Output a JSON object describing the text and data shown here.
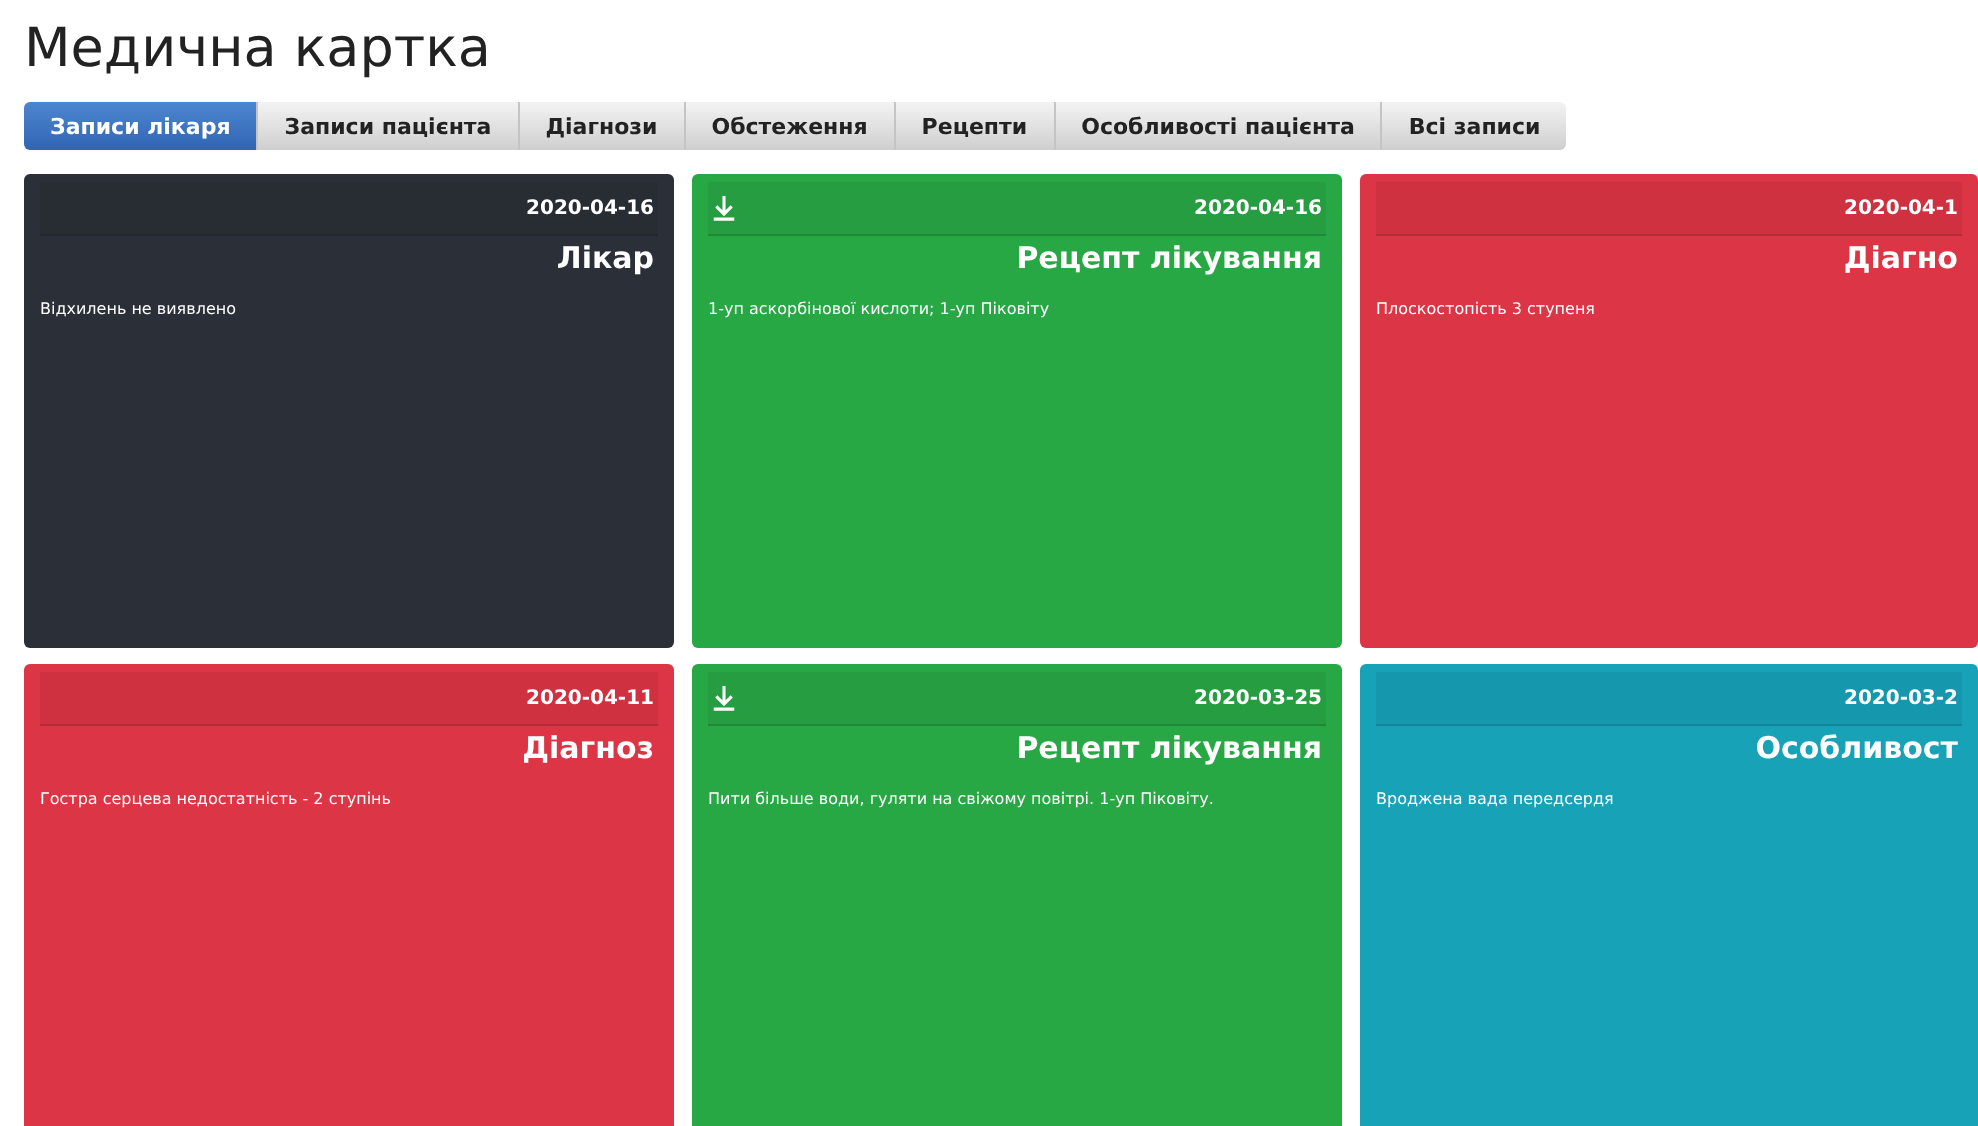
{
  "page_title": "Медична картка",
  "tabs": [
    {
      "label": "Записи лікаря",
      "selected": true
    },
    {
      "label": "Записи пацієнта",
      "selected": false
    },
    {
      "label": "Діагнози",
      "selected": false
    },
    {
      "label": "Обстеження",
      "selected": false
    },
    {
      "label": "Рецепти",
      "selected": false
    },
    {
      "label": "Особливості пацієнта",
      "selected": false
    },
    {
      "label": "Всі записи",
      "selected": false
    }
  ],
  "cards": [
    {
      "date": "2020-04-16",
      "title": "Лікар",
      "text": "Відхилень не виявлено",
      "color": "#2b3038",
      "download": false
    },
    {
      "date": "2020-04-16",
      "title": "Рецепт лікування",
      "text": "1-уп аскорбінової кислоти; 1-уп Піковіту",
      "color": "#28a745",
      "download": true
    },
    {
      "date": "2020-04-1",
      "title": "Діагно",
      "text": "Плоскостопість 3 ступеня",
      "color": "#dc3545",
      "download": false
    },
    {
      "date": "2020-04-11",
      "title": "Діагноз",
      "text": "Гостра серцева недостатність - 2 ступінь",
      "color": "#dc3545",
      "download": false
    },
    {
      "date": "2020-03-25",
      "title": "Рецепт лікування",
      "text": "Пити більше води, гуляти на свіжому повітрі. 1-уп Піковіту.",
      "color": "#28a745",
      "download": true
    },
    {
      "date": "2020-03-2",
      "title": "Особливост",
      "text": "Вроджена вада передсердя",
      "color": "#17a2b8",
      "download": false
    }
  ]
}
